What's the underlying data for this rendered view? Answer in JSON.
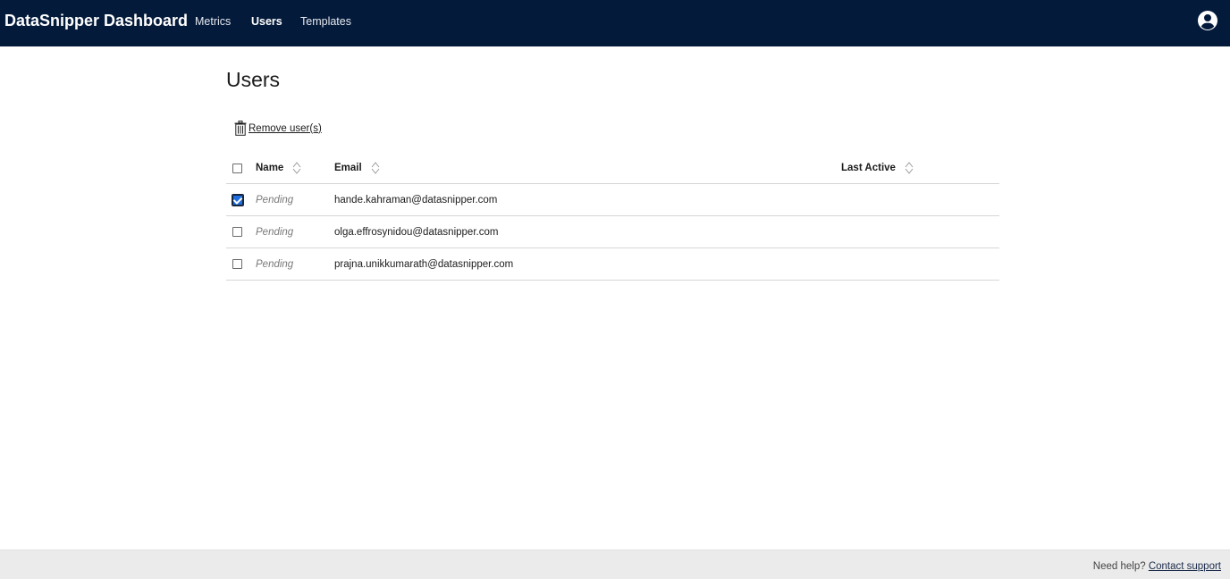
{
  "header": {
    "brand": "DataSnipper Dashboard",
    "nav": [
      {
        "label": "Metrics",
        "active": false
      },
      {
        "label": "Users",
        "active": true
      },
      {
        "label": "Templates",
        "active": false
      }
    ],
    "account_icon": "account-circle-icon"
  },
  "page": {
    "title": "Users",
    "remove_label": "Remove user(s)",
    "remove_icon": "trash-icon"
  },
  "table": {
    "columns": {
      "name": "Name",
      "email": "Email",
      "last_active": "Last Active"
    },
    "rows": [
      {
        "name": "Pending",
        "email": "hande.kahraman@datasnipper.com",
        "last_active": "",
        "checked": true
      },
      {
        "name": "Pending",
        "email": "olga.effrosynidou@datasnipper.com",
        "last_active": "",
        "checked": false
      },
      {
        "name": "Pending",
        "email": "prajna.unikkumarath@datasnipper.com",
        "last_active": "",
        "checked": false
      }
    ]
  },
  "footer": {
    "help_text": "Need help?",
    "link_text": "Contact support"
  },
  "colors": {
    "topbar": "#041a3a",
    "checkbox_checked": "#1d6ee0",
    "footer_bg": "#ebebeb"
  }
}
